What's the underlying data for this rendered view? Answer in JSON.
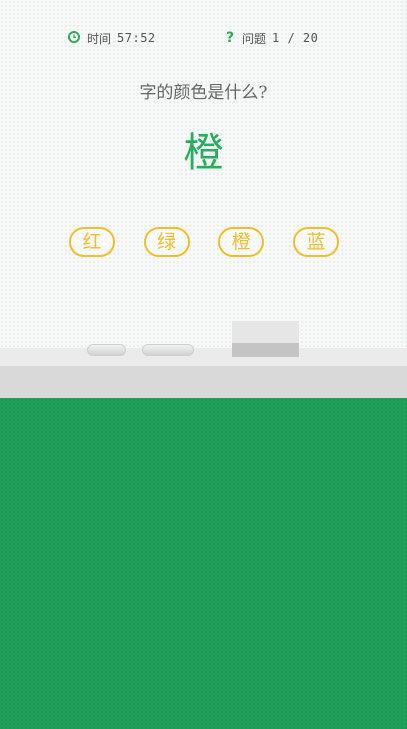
{
  "status": {
    "time_label": "时间",
    "time_value": "57:52",
    "time_icon": "clock-icon",
    "question_label": "问题",
    "question_value": "1 / 20",
    "question_icon": "question-mark-icon"
  },
  "prompt": "字的颜色是什么?",
  "target": {
    "word": "橙",
    "ink_color": "#27ad5e"
  },
  "options": [
    "红",
    "绿",
    "橙",
    "蓝"
  ],
  "colors": {
    "accent_green": "#2eaa5c",
    "option_border": "#f2be2c",
    "bottom_panel": "#21a05a"
  }
}
